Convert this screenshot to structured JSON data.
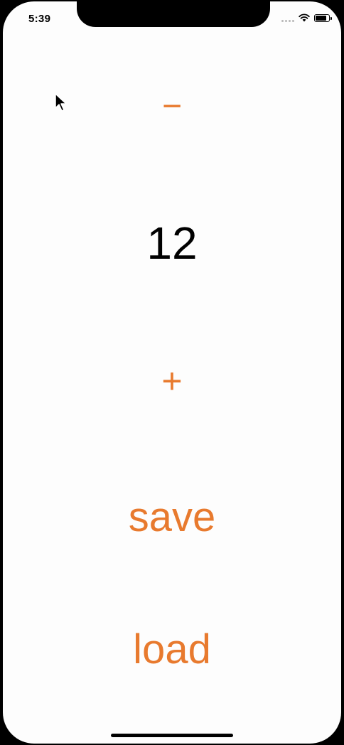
{
  "status_bar": {
    "time": "5:39",
    "battery_level": 0.85
  },
  "counter": {
    "decrement_label": "−",
    "value": "12",
    "increment_label": "+"
  },
  "actions": {
    "save_label": "save",
    "load_label": "load"
  },
  "icons": [
    "mouse-cursor-icon",
    "signal-icon",
    "wifi-icon",
    "battery-icon"
  ],
  "colors": {
    "accent": "#e87a2e",
    "text": "#000000",
    "background": "#fdfdfd"
  }
}
